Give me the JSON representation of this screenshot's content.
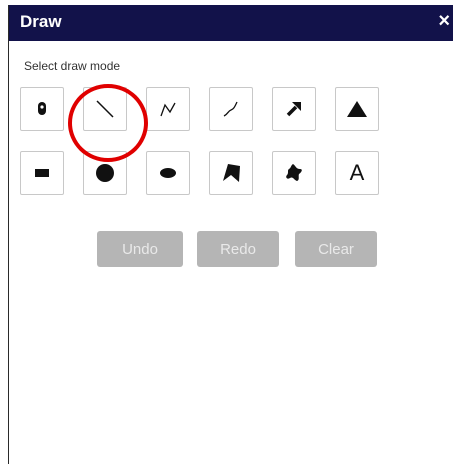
{
  "window": {
    "title": "Draw",
    "close_glyph": "×"
  },
  "select_label": "Select draw mode",
  "tools": [
    {
      "name": "point",
      "icon": "pin-icon"
    },
    {
      "name": "line",
      "icon": "line-icon",
      "highlighted": true
    },
    {
      "name": "polyline",
      "icon": "polyline-icon"
    },
    {
      "name": "freehand-polyline",
      "icon": "freehand-line-icon"
    },
    {
      "name": "arrow",
      "icon": "arrow-icon"
    },
    {
      "name": "triangle",
      "icon": "triangle-icon"
    },
    {
      "name": "rectangle",
      "icon": "rectangle-icon"
    },
    {
      "name": "circle",
      "icon": "circle-icon"
    },
    {
      "name": "ellipse",
      "icon": "ellipse-icon"
    },
    {
      "name": "polygon",
      "icon": "polygon-icon"
    },
    {
      "name": "freehand-polygon",
      "icon": "freehand-polygon-icon"
    },
    {
      "name": "text",
      "icon": "text-icon",
      "label": "A"
    }
  ],
  "actions": {
    "undo": "Undo",
    "redo": "Redo",
    "clear": "Clear"
  },
  "colors": {
    "titlebar": "#12124a",
    "disabled_button": "#b5b5b5",
    "highlight": "#e00000"
  }
}
